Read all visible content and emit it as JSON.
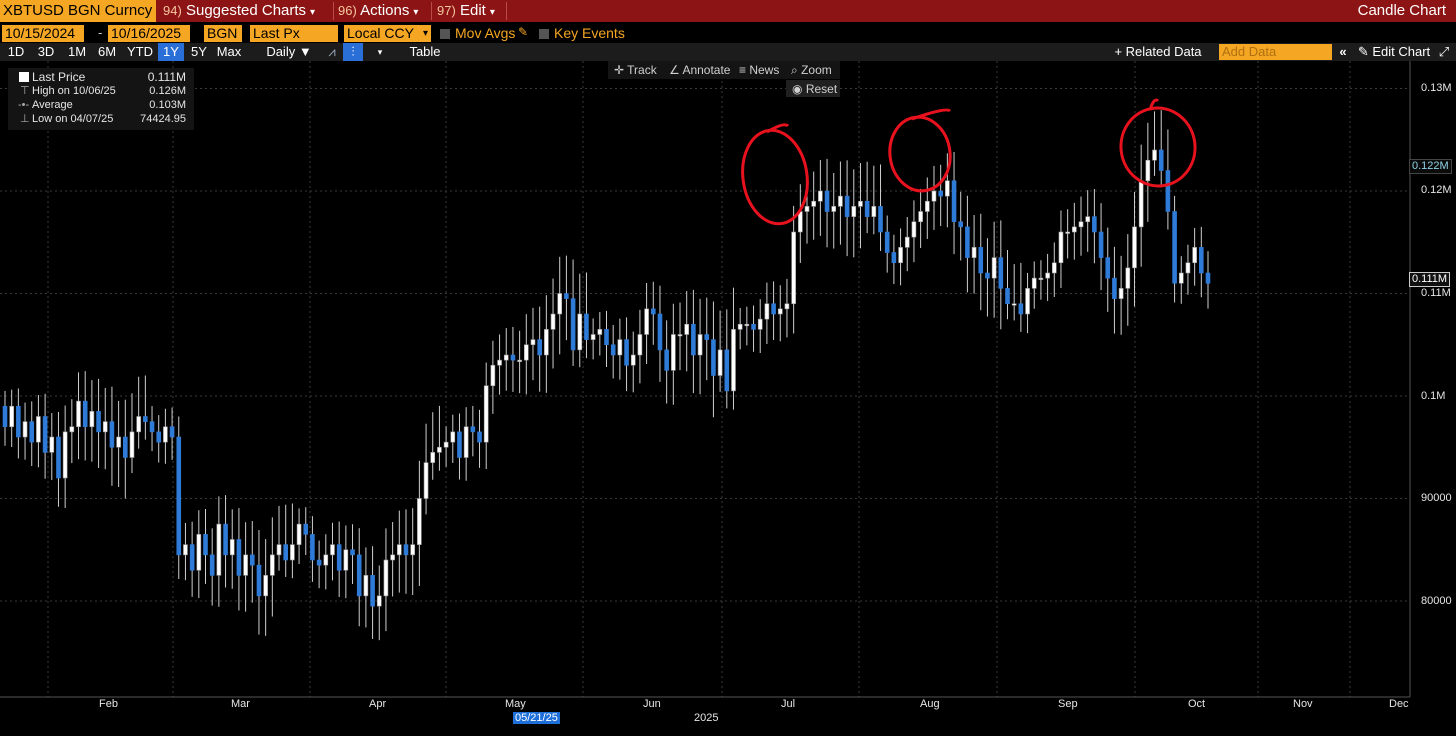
{
  "topbar": {
    "ticker": "XBTUSD BGN Curncy",
    "suggested_num": "94)",
    "suggested_label": "Suggested Charts",
    "actions_num": "96)",
    "actions_label": "Actions",
    "edit_num": "97)",
    "edit_label": "Edit",
    "title": "Candle Chart"
  },
  "params": {
    "start_date": "10/15/2024",
    "end_date": "10/16/2025",
    "source": "BGN",
    "field": "Last Px",
    "currency": "Local CCY",
    "mov_avgs": "Mov Avgs",
    "key_events": "Key Events"
  },
  "periods": [
    "1D",
    "3D",
    "1M",
    "6M",
    "YTD",
    "1Y",
    "5Y",
    "Max"
  ],
  "active_period": "1Y",
  "toolbar": {
    "freq": "Daily ▼",
    "table": "Table",
    "related": "+ Related Data",
    "add_data_placeholder": "Add Data",
    "edit_chart": "Edit Chart"
  },
  "tools": {
    "track": "Track",
    "annotate": "Annotate",
    "news": "News",
    "zoom": "Zoom",
    "reset": "Reset"
  },
  "legend": {
    "last_label": "Last Price",
    "last_value": "0.111M",
    "high_label": "High on 10/06/25",
    "high_value": "0.126M",
    "avg_label": "Average",
    "avg_value": "0.103M",
    "low_label": "Low on 04/07/25",
    "low_value": "74424.95"
  },
  "yaxis": {
    "ticks": [
      "0.13M",
      "0.12M",
      "0.11M",
      "0.1M",
      "90000",
      "80000"
    ],
    "flag_high": "0.122M",
    "flag_last": "0.111M"
  },
  "xaxis": {
    "months": [
      "Feb",
      "Mar",
      "Apr",
      "May",
      "Jun",
      "Jul",
      "Aug",
      "Sep",
      "Oct",
      "Nov",
      "Dec"
    ],
    "year": "2025",
    "cursor_date": "05/21/25"
  },
  "colors": {
    "up": "#ffffff",
    "down": "#2f7bd8",
    "annotation": "#e8121e",
    "accent": "#f5a623",
    "bar": "#8c1414"
  },
  "chart_data": {
    "type": "candlestick",
    "title": "",
    "ylabel": "",
    "ylim": [
      70000,
      135000
    ],
    "x_range": [
      "2025-01-01",
      "2025-12-31"
    ],
    "series": [
      {
        "close": [
          97000,
          99000,
          96000,
          97500,
          95500,
          98000,
          94500,
          96000,
          92000,
          96500,
          97000,
          99500,
          97000,
          98500,
          96500,
          97500,
          95000,
          96000,
          94000,
          96500,
          98000,
          97500,
          96500,
          95500,
          97000,
          96000,
          84500,
          85500,
          83000,
          86500,
          84500,
          82500,
          87500,
          84500,
          86000,
          82500,
          84500,
          83500,
          80500,
          82500,
          84500,
          85500,
          84000,
          85500,
          87500,
          86500,
          84000,
          83500,
          84500,
          85500,
          83000,
          85000,
          84500,
          80500,
          82500,
          79500,
          80500,
          84000,
          84500,
          85500,
          84500,
          85500,
          90000,
          93500,
          94500,
          95000,
          95500,
          96500,
          94000,
          97000,
          96500,
          95500,
          101000,
          103000,
          103500,
          104000,
          103500,
          103500,
          105000,
          105500,
          104000,
          106500,
          108000,
          110000,
          109500,
          104500,
          108000,
          105500,
          106000,
          106500,
          105000,
          104000,
          105500,
          103000,
          104000,
          106000,
          108500,
          108000,
          104500,
          102500,
          106000,
          106000,
          107000,
          104000,
          106000,
          105500,
          102000,
          104500,
          100500,
          106500,
          107000,
          107000,
          106500,
          107500,
          109000,
          108000,
          108500,
          109000,
          116000,
          118000,
          118500,
          119000,
          120000,
          118000,
          118500,
          119500,
          117500,
          118500,
          119000,
          117500,
          118500,
          116000,
          114000,
          113000,
          114500,
          115500,
          117000,
          118000,
          119000,
          120000,
          119500,
          121000,
          117000,
          116500,
          113500,
          114500,
          112000,
          111500,
          113500,
          110500,
          109000,
          109000,
          108000,
          110500,
          111500,
          111500,
          112000,
          113000,
          116000,
          116000,
          116500,
          117000,
          117500,
          116000,
          113500,
          111500,
          109500,
          110500,
          112500,
          116500,
          121000,
          123000,
          124000,
          122000,
          118000,
          111000,
          112000,
          113000,
          114500,
          112000,
          111000
        ]
      }
    ]
  }
}
